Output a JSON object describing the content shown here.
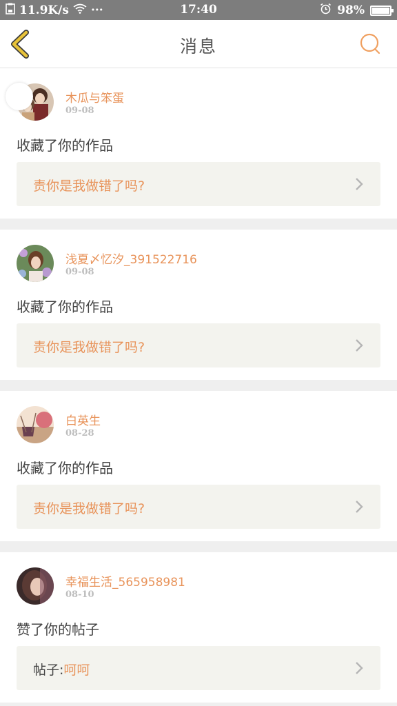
{
  "status_bar": {
    "net_speed": "11.9K/s",
    "dots": "···",
    "time": "17:40",
    "battery": "98%",
    "battery_level": 0.98
  },
  "header": {
    "title": "消息",
    "back_icon": "chevron-left-icon",
    "search_icon": "search-icon"
  },
  "colors": {
    "accent": "#e8935a",
    "back": "#e8c33a"
  },
  "messages": [
    {
      "username": "木瓜与笨蛋",
      "date": "09-08",
      "action": "收藏了你的作品",
      "quote_label": "",
      "quote_text": "责你是我做错了吗?"
    },
    {
      "username": "浅夏〆忆汐_391522716",
      "date": "09-08",
      "action": "收藏了你的作品",
      "quote_label": "",
      "quote_text": "责你是我做错了吗?"
    },
    {
      "username": "白英生",
      "date": "08-28",
      "action": "收藏了你的作品",
      "quote_label": "",
      "quote_text": "责你是我做错了吗?"
    },
    {
      "username": "幸福生活_565958981",
      "date": "08-10",
      "action": "赞了你的帖子",
      "quote_label": "帖子:",
      "quote_text": "呵呵"
    }
  ]
}
